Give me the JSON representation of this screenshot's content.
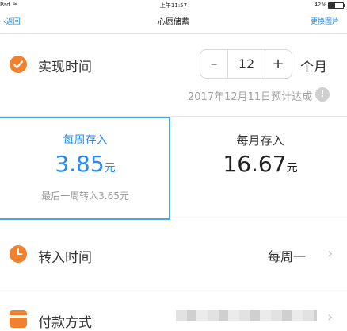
{
  "status_bar": {
    "device": "Pad",
    "time": "上午11:57",
    "battery": "42%"
  },
  "nav": {
    "back": "返回",
    "title": "心愿储蓄",
    "right_action": "更换图片"
  },
  "realize_time": {
    "label": "实现时间",
    "stepper": {
      "minus": "–",
      "value": "12",
      "plus": "+"
    },
    "unit": "个月",
    "estimate": "2017年12月11日预计达成",
    "info_icon": "!"
  },
  "plans": [
    {
      "label": "每周存入",
      "amount": "3.85",
      "currency": "元",
      "note": "最后一周转入3.65元",
      "selected": true
    },
    {
      "label": "每月存入",
      "amount": "16.67",
      "currency": "元",
      "selected": false
    }
  ],
  "transfer_time": {
    "label": "转入时间",
    "value": "每周一"
  },
  "payment": {
    "label": "付款方式"
  },
  "colors": {
    "accent": "#f0822f",
    "link": "#2a8bf2",
    "selected_border": "#4aa3e6"
  },
  "icons": [
    "wifi-icon",
    "check-circle-icon",
    "info-icon",
    "clock-icon",
    "card-icon",
    "chevron-right-icon"
  ]
}
